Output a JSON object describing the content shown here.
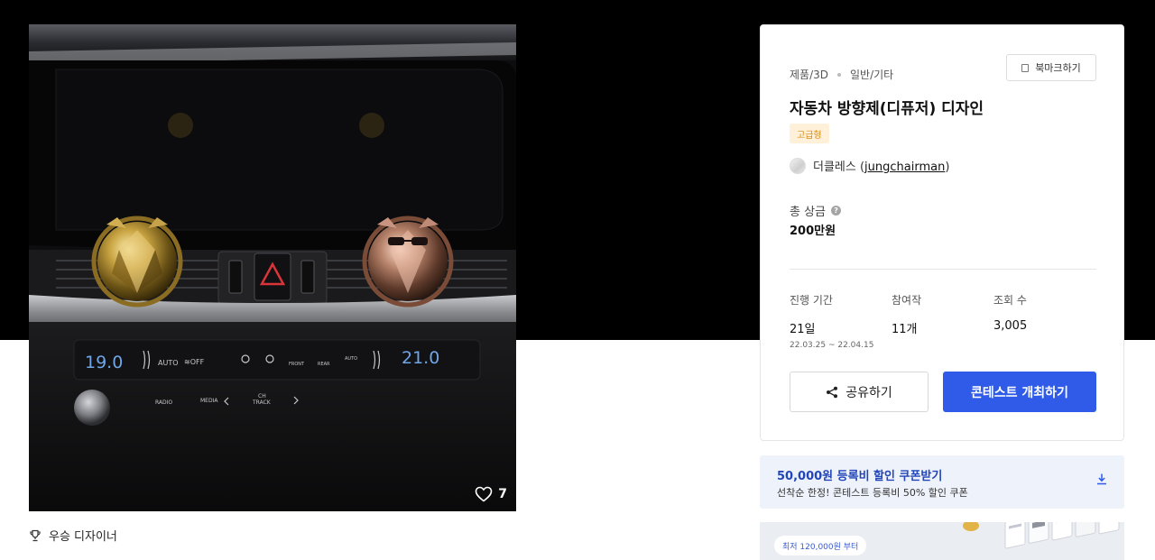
{
  "product": {
    "likes": "7",
    "winner_label": "우승 디자이너"
  },
  "console": {
    "temp_left": "19.0",
    "temp_right": "21.0",
    "btn_auto": "AUTO",
    "btn_off": "≋OFF",
    "btn_front": "FRONT",
    "btn_rear": "REAR",
    "btn_auto2": "AUTO",
    "btn_radio": "RADIO",
    "btn_media": "MEDIA",
    "btn_ch": "CH",
    "btn_track": "TRACK"
  },
  "card": {
    "category_main": "제품/3D",
    "category_sub": "일반/기타",
    "bookmark_label": "북마크하기",
    "title": "자동차 방향제(디퓨저) 디자인",
    "grade_badge": "고급형",
    "host_name": "더클레스 (",
    "host_id": "jungchairman",
    "host_close": ")",
    "prize_label": "총 상금",
    "prize_help": "?",
    "prize_value": "200만원",
    "stats": {
      "period_label": "진행 기간",
      "period_value": "21일",
      "period_range": "22.03.25 ~ 22.04.15",
      "entries_label": "참여작",
      "entries_value": "11개",
      "views_label": "조회 수",
      "views_value": "3,005"
    },
    "share_label": "공유하기",
    "host_contest_label": "콘테스트 개최하기"
  },
  "coupon": {
    "title": "50,000원 등록비 할인 쿠폰받기",
    "desc": "선착순 한정! 콘테스트 등록비 50% 할인 쿠폰"
  },
  "promo": {
    "pill": "최저 120,000원 부터"
  },
  "colors": {
    "primary": "#2f5be8",
    "coupon_text": "#2246b8",
    "badge_bg": "#fff1d9",
    "badge_text": "#d98a12"
  },
  "icons": {
    "heart": "heart-icon",
    "trophy": "trophy-icon",
    "bookmark": "bookmark-icon",
    "share": "share-icon",
    "help": "help-icon",
    "download": "download-icon"
  }
}
